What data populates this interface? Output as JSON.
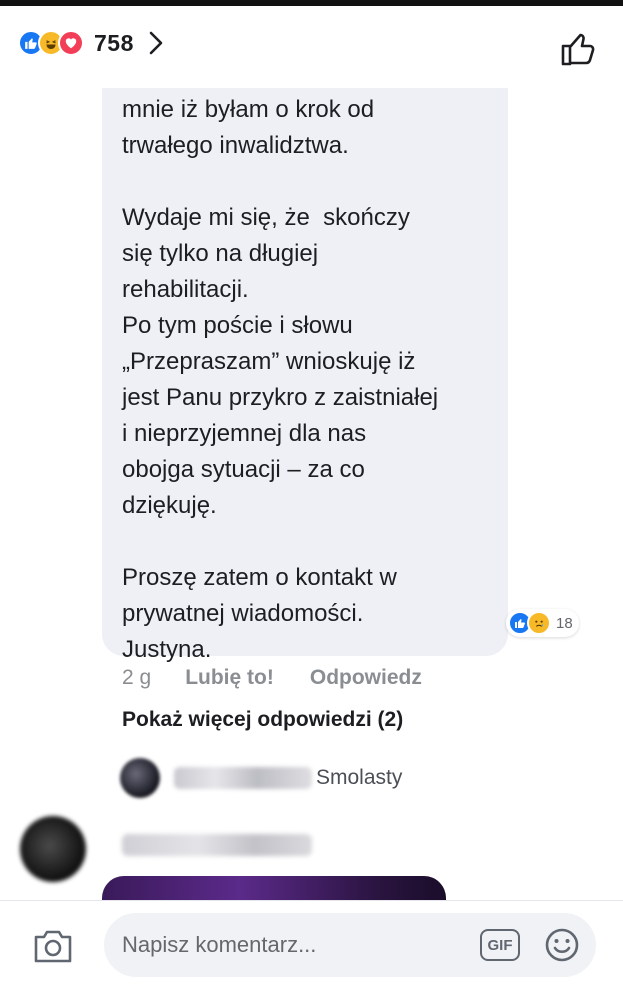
{
  "header": {
    "reaction_icons": [
      "like-reaction-icon",
      "haha-reaction-icon",
      "love-reaction-icon"
    ],
    "reaction_count": "758",
    "chevron_icon": "chevron-right-icon",
    "like_icon": "thumbs-up-icon"
  },
  "comment": {
    "text": "mnie iż byłam o krok od\ntrwałego inwalidztwa.\n\nWydaje mi się, że  skończy\nsię tylko na długiej\nrehabilitacji.\nPo tym poście i słowu\n„Przepraszam” wnioskuję iż\njest Panu przykro z zaistniałej\ni nieprzyjemnej dla nas\nobojga sytuacji – za co\ndziękuję.\n\nProszę zatem o kontakt w\nprywatnej wiadomości.\nJustyna.",
    "reactions": [
      "like-reaction-icon",
      "sad-reaction-icon"
    ],
    "reaction_count": "18",
    "time": "2 g",
    "like_label": "Lubię to!",
    "reply_label": "Odpowiedz",
    "more_replies": "Pokaż więcej odpowiedzi (2)",
    "reply_preview_name": "Smolasty"
  },
  "composer": {
    "camera_icon": "camera-icon",
    "placeholder": "Napisz komentarz...",
    "gif_label": "GIF",
    "emoji_icon": "smiley-icon"
  },
  "colors": {
    "like_blue": "#1877f2",
    "love_red": "#f33e58",
    "haha_yellow": "#f7b928",
    "bubble_bg": "#eff0f5",
    "secondary_text": "#8a8d91"
  }
}
